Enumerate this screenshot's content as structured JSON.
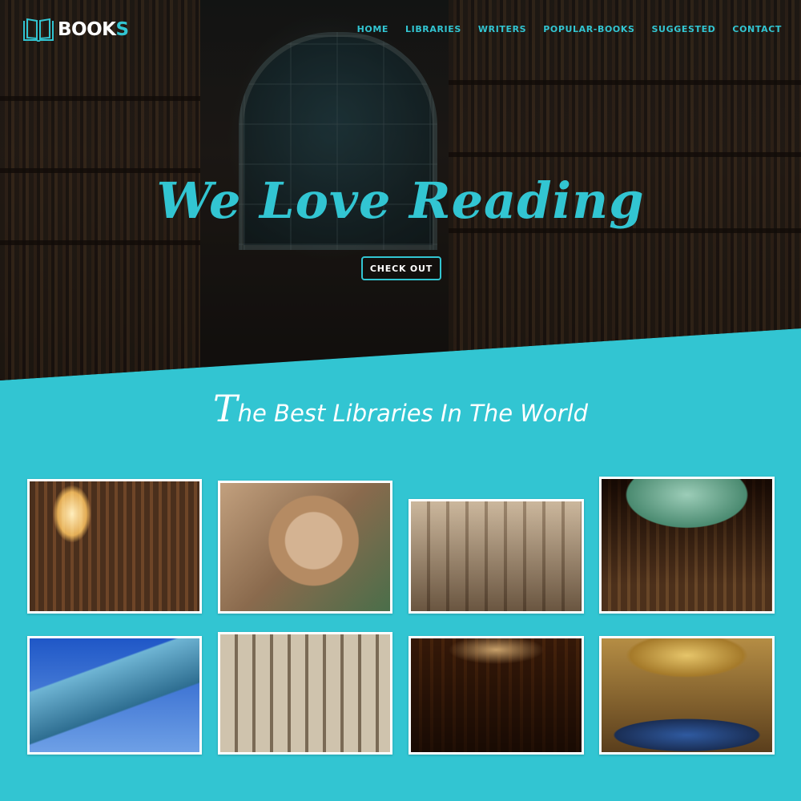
{
  "brand": {
    "logo_main": "BOOK",
    "logo_accent": "S"
  },
  "nav": {
    "items": [
      "HOME",
      "LIBRARIES",
      "WRITERS",
      "POPULAR-BOOKS",
      "SUGGESTED",
      "CONTACT"
    ]
  },
  "hero": {
    "title": "We Love Reading",
    "cta_label": "CHECK OUT"
  },
  "section": {
    "title_cap": "T",
    "title_rest": "he Best Libraries In The World"
  },
  "gallery": {
    "count": 8
  },
  "colors": {
    "accent": "#32c5d2",
    "white": "#ffffff"
  },
  "icons": {
    "logo": "open-book-icon"
  }
}
